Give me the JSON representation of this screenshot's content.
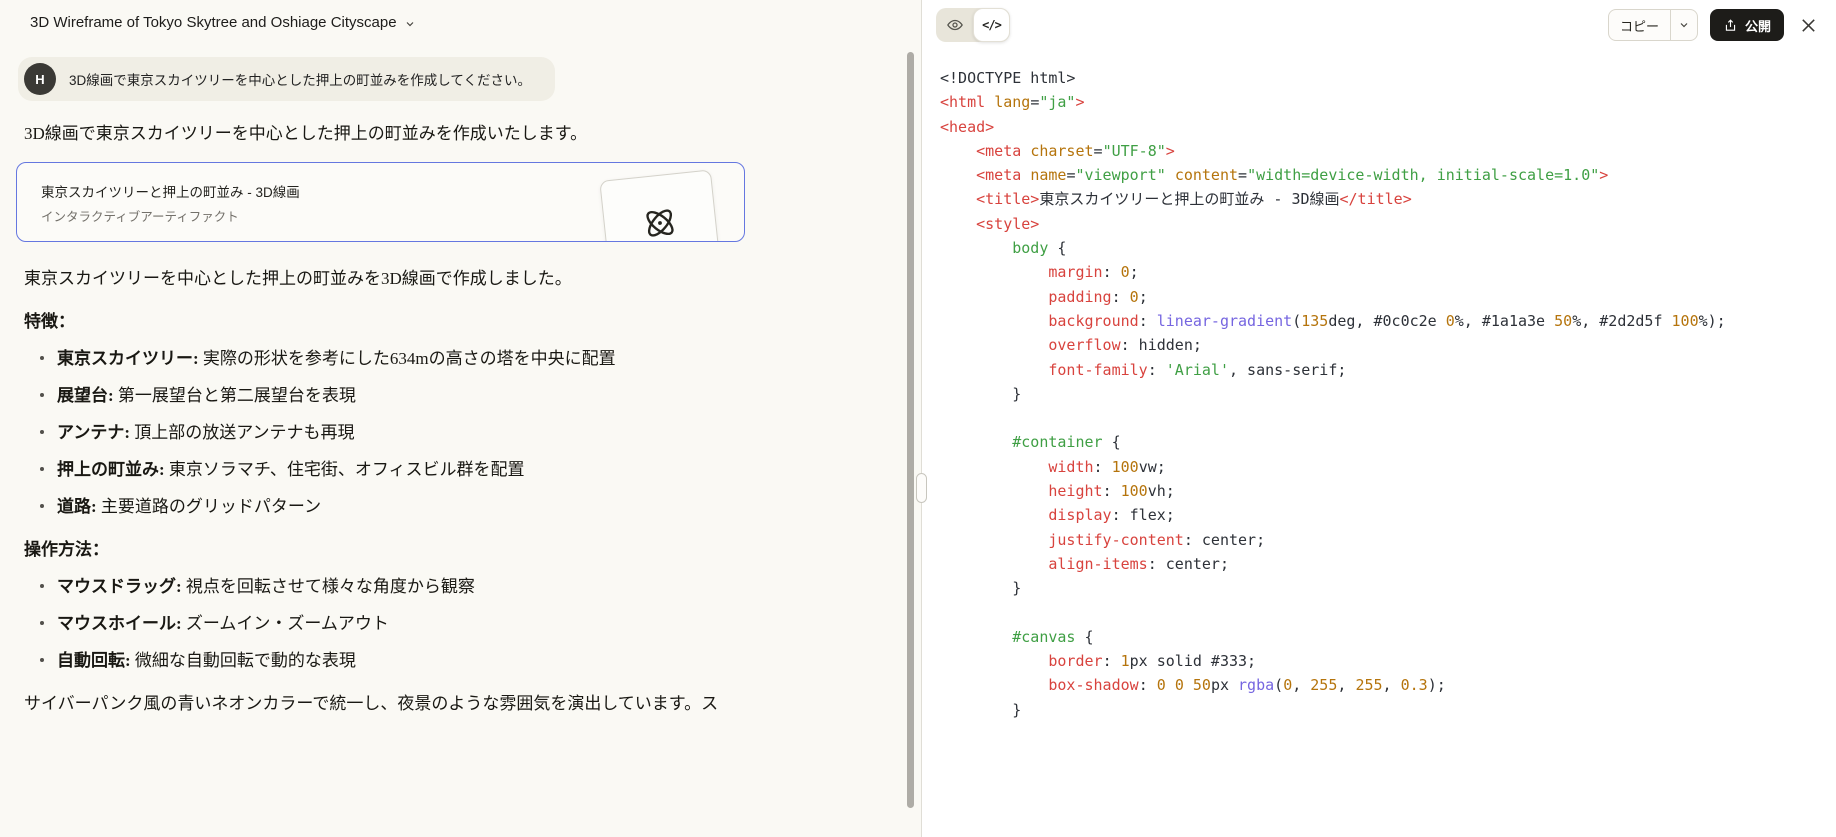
{
  "colors": {
    "page_bg": "#faf9f4",
    "panel_bg": "#ffffff",
    "bubble_bg": "#f0eee5",
    "avatar_bg": "#3a3935",
    "text": "#1c1b17",
    "muted": "#73706a",
    "accent_blue": "#6577e0",
    "card_bg": "#fcfbf8",
    "divider": "#e0ded6",
    "toggle_bg": "#e8e5da",
    "button_border": "#d9d6cc",
    "publish_bg": "#1d1c19",
    "scrollbar": "#aeaca6",
    "code_plain": "#2d3138",
    "code_red": "#d8433e",
    "code_orange": "#b5740c",
    "code_green": "#3f9f44",
    "code_violet": "#7565e0"
  },
  "chat": {
    "title": "3D Wireframe of Tokyo Skytree and Oshiage Cityscape",
    "avatar_initial": "H",
    "user_message": "3D線画で東京スカイツリーを中心とした押上の町並みを作成してください。",
    "intro": "3D線画で東京スカイツリーを中心とした押上の町並みを作成いたします。",
    "artifact_card": {
      "title": "東京スカイツリーと押上の町並み - 3D線画",
      "subtitle": "インタラクティブアーティファクト",
      "icon": "atom-icon"
    },
    "result": "東京スカイツリーを中心とした押上の町並みを3D線画で作成しました。",
    "features_heading": "特徴：",
    "features": [
      {
        "term": "東京スカイツリー:",
        "desc": "実際の形状を参考にした634mの高さの塔を中央に配置"
      },
      {
        "term": "展望台:",
        "desc": "第一展望台と第二展望台を表現"
      },
      {
        "term": "アンテナ:",
        "desc": "頂上部の放送アンテナも再現"
      },
      {
        "term": "押上の町並み:",
        "desc": "東京ソラマチ、住宅街、オフィスビル群を配置"
      },
      {
        "term": "道路:",
        "desc": "主要道路のグリッドパターン"
      }
    ],
    "controls_heading": "操作方法：",
    "controls": [
      {
        "term": "マウスドラッグ:",
        "desc": "視点を回転させて様々な角度から観察"
      },
      {
        "term": "マウスホイール:",
        "desc": "ズームイン・ズームアウト"
      },
      {
        "term": "自動回転:",
        "desc": "微細な自動回転で動的な表現"
      }
    ],
    "outro": "サイバーパンク風の青いネオンカラーで統一し、夜景のような雰囲気を演出しています。ス"
  },
  "artifact_panel": {
    "code_toggle_label": "</>",
    "copy_label": "コピー",
    "publish_label": "公開",
    "code_lines": [
      [
        [
          "p",
          "<!DOCTYPE html>"
        ]
      ],
      [
        [
          "r",
          "<html"
        ],
        [
          "p",
          " "
        ],
        [
          "o",
          "lang"
        ],
        [
          "p",
          "="
        ],
        [
          "g",
          "\"ja\""
        ],
        [
          "r",
          ">"
        ]
      ],
      [
        [
          "r",
          "<head>"
        ]
      ],
      [
        [
          "p",
          "    "
        ],
        [
          "r",
          "<meta"
        ],
        [
          "p",
          " "
        ],
        [
          "o",
          "charset"
        ],
        [
          "p",
          "="
        ],
        [
          "g",
          "\"UTF-8\""
        ],
        [
          "r",
          ">"
        ]
      ],
      [
        [
          "p",
          "    "
        ],
        [
          "r",
          "<meta"
        ],
        [
          "p",
          " "
        ],
        [
          "o",
          "name"
        ],
        [
          "p",
          "="
        ],
        [
          "g",
          "\"viewport\""
        ],
        [
          "p",
          " "
        ],
        [
          "o",
          "content"
        ],
        [
          "p",
          "="
        ],
        [
          "g",
          "\"width=device-width, initial-scale=1.0\""
        ],
        [
          "r",
          ">"
        ]
      ],
      [
        [
          "p",
          "    "
        ],
        [
          "r",
          "<title>"
        ],
        [
          "p",
          "東京スカイツリーと押上の町並み - 3D線画"
        ],
        [
          "r",
          "</title>"
        ]
      ],
      [
        [
          "p",
          "    "
        ],
        [
          "r",
          "<style>"
        ]
      ],
      [
        [
          "p",
          "        "
        ],
        [
          "g",
          "body"
        ],
        [
          "p",
          " {"
        ]
      ],
      [
        [
          "p",
          "            "
        ],
        [
          "r",
          "margin"
        ],
        [
          "p",
          ": "
        ],
        [
          "o",
          "0"
        ],
        [
          "p",
          ";"
        ]
      ],
      [
        [
          "p",
          "            "
        ],
        [
          "r",
          "padding"
        ],
        [
          "p",
          ": "
        ],
        [
          "o",
          "0"
        ],
        [
          "p",
          ";"
        ]
      ],
      [
        [
          "p",
          "            "
        ],
        [
          "r",
          "background"
        ],
        [
          "p",
          ": "
        ],
        [
          "v",
          "linear-gradient"
        ],
        [
          "p",
          "("
        ],
        [
          "o",
          "135"
        ],
        [
          "p",
          "deg, #0c0c2e "
        ],
        [
          "o",
          "0"
        ],
        [
          "p",
          "%, #1a1a3e "
        ],
        [
          "o",
          "50"
        ],
        [
          "p",
          "%, #2d2d5f "
        ],
        [
          "o",
          "100"
        ],
        [
          "p",
          "%);"
        ]
      ],
      [
        [
          "p",
          "            "
        ],
        [
          "r",
          "overflow"
        ],
        [
          "p",
          ": hidden;"
        ]
      ],
      [
        [
          "p",
          "            "
        ],
        [
          "r",
          "font-family"
        ],
        [
          "p",
          ": "
        ],
        [
          "g",
          "'Arial'"
        ],
        [
          "p",
          ", sans-serif;"
        ]
      ],
      [
        [
          "p",
          "        }"
        ]
      ],
      [],
      [
        [
          "p",
          "        "
        ],
        [
          "g",
          "#container"
        ],
        [
          "p",
          " {"
        ]
      ],
      [
        [
          "p",
          "            "
        ],
        [
          "r",
          "width"
        ],
        [
          "p",
          ": "
        ],
        [
          "o",
          "100"
        ],
        [
          "p",
          "vw;"
        ]
      ],
      [
        [
          "p",
          "            "
        ],
        [
          "r",
          "height"
        ],
        [
          "p",
          ": "
        ],
        [
          "o",
          "100"
        ],
        [
          "p",
          "vh;"
        ]
      ],
      [
        [
          "p",
          "            "
        ],
        [
          "r",
          "display"
        ],
        [
          "p",
          ": flex;"
        ]
      ],
      [
        [
          "p",
          "            "
        ],
        [
          "r",
          "justify-content"
        ],
        [
          "p",
          ": center;"
        ]
      ],
      [
        [
          "p",
          "            "
        ],
        [
          "r",
          "align-items"
        ],
        [
          "p",
          ": center;"
        ]
      ],
      [
        [
          "p",
          "        }"
        ]
      ],
      [],
      [
        [
          "p",
          "        "
        ],
        [
          "g",
          "#canvas"
        ],
        [
          "p",
          " {"
        ]
      ],
      [
        [
          "p",
          "            "
        ],
        [
          "r",
          "border"
        ],
        [
          "p",
          ": "
        ],
        [
          "o",
          "1"
        ],
        [
          "p",
          "px solid #333;"
        ]
      ],
      [
        [
          "p",
          "            "
        ],
        [
          "r",
          "box-shadow"
        ],
        [
          "p",
          ": "
        ],
        [
          "o",
          "0"
        ],
        [
          "p",
          " "
        ],
        [
          "o",
          "0"
        ],
        [
          "p",
          " "
        ],
        [
          "o",
          "50"
        ],
        [
          "p",
          "px "
        ],
        [
          "v",
          "rgba"
        ],
        [
          "p",
          "("
        ],
        [
          "o",
          "0"
        ],
        [
          "p",
          ", "
        ],
        [
          "o",
          "255"
        ],
        [
          "p",
          ", "
        ],
        [
          "o",
          "255"
        ],
        [
          "p",
          ", "
        ],
        [
          "o",
          "0.3"
        ],
        [
          "p",
          ");"
        ]
      ],
      [
        [
          "p",
          "        }"
        ]
      ]
    ]
  }
}
